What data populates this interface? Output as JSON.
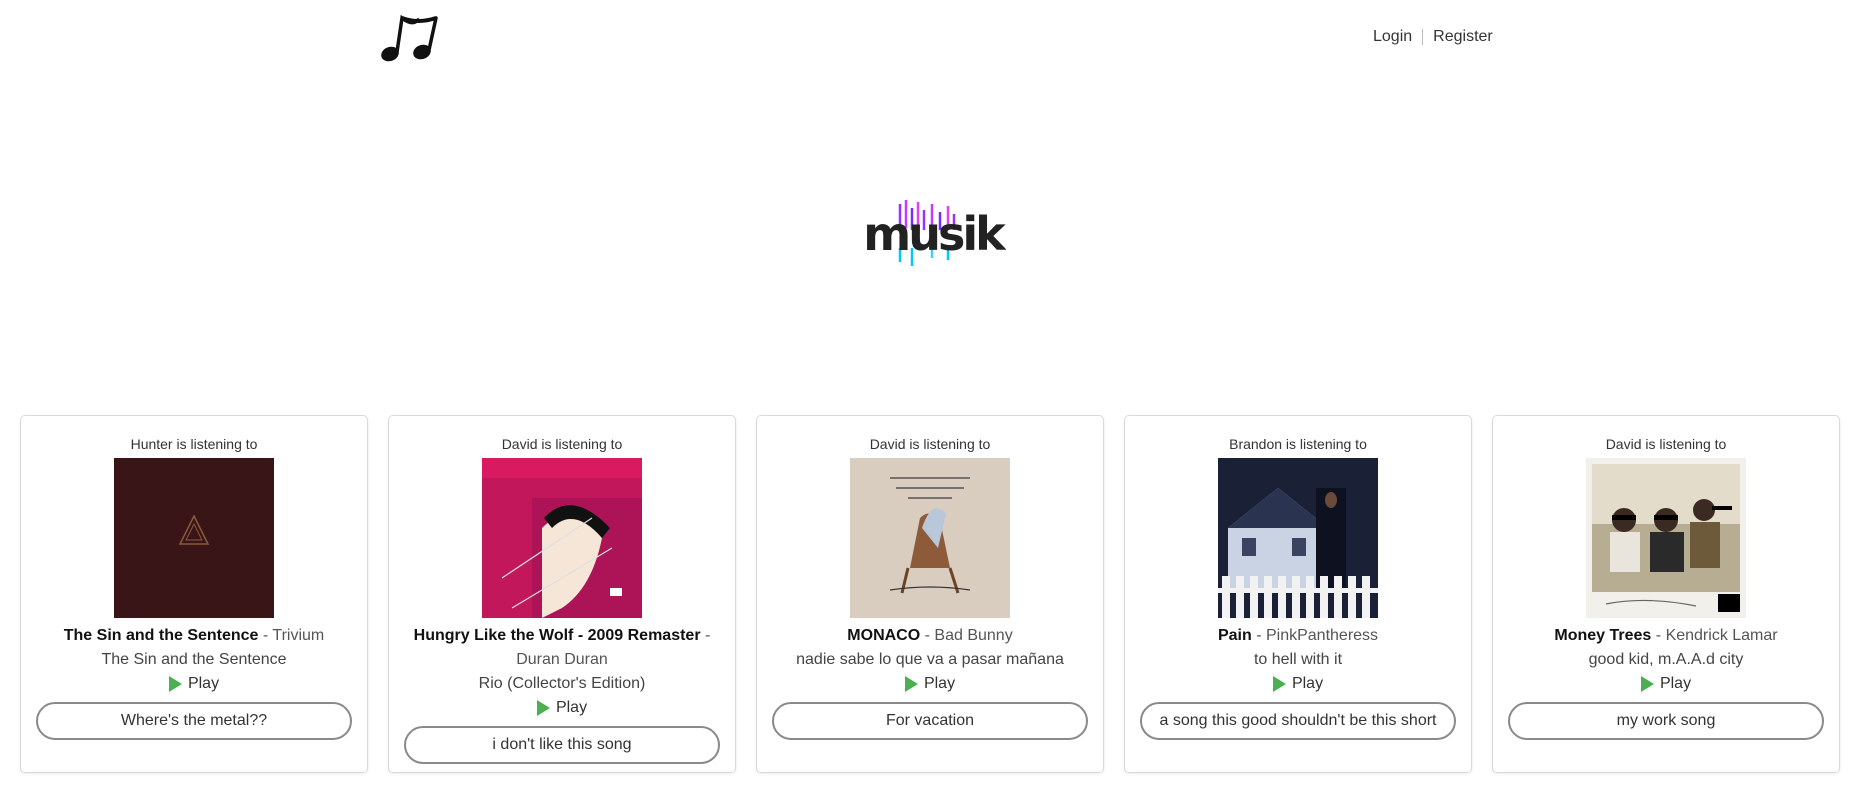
{
  "header": {
    "logo_icon": "music-notes-icon",
    "login_label": "Login",
    "register_label": "Register"
  },
  "brand": {
    "name": "musik"
  },
  "colors": {
    "play": "#4caf50",
    "brand_text": "#222222",
    "brand_accent": "#9b30ff",
    "brand_cyan": "#00c8ff"
  },
  "cards": [
    {
      "user_text": "Hunter is listening to",
      "song": "The Sin and the Sentence",
      "artist": "Trivium",
      "album": "The Sin and the Sentence",
      "play_label": "Play",
      "comment": "Where's the metal??"
    },
    {
      "user_text": "David is listening to",
      "song": "Hungry Like the Wolf - 2009 Remaster",
      "artist": "Duran Duran",
      "album": "Rio (Collector's Edition)",
      "play_label": "Play",
      "comment": "i don't like this song"
    },
    {
      "user_text": "David is listening to",
      "song": "MONACO",
      "artist": "Bad Bunny",
      "album": "nadie sabe lo que va a pasar mañana",
      "play_label": "Play",
      "comment": "For vacation"
    },
    {
      "user_text": "Brandon is listening to",
      "song": "Pain",
      "artist": "PinkPantheress",
      "album": "to hell with it",
      "play_label": "Play",
      "comment": "a song this good shouldn't be this short"
    },
    {
      "user_text": "David is listening to",
      "song": "Money Trees",
      "artist": "Kendrick Lamar",
      "album": "good kid, m.A.A.d city",
      "play_label": "Play",
      "comment": "my work song"
    }
  ]
}
